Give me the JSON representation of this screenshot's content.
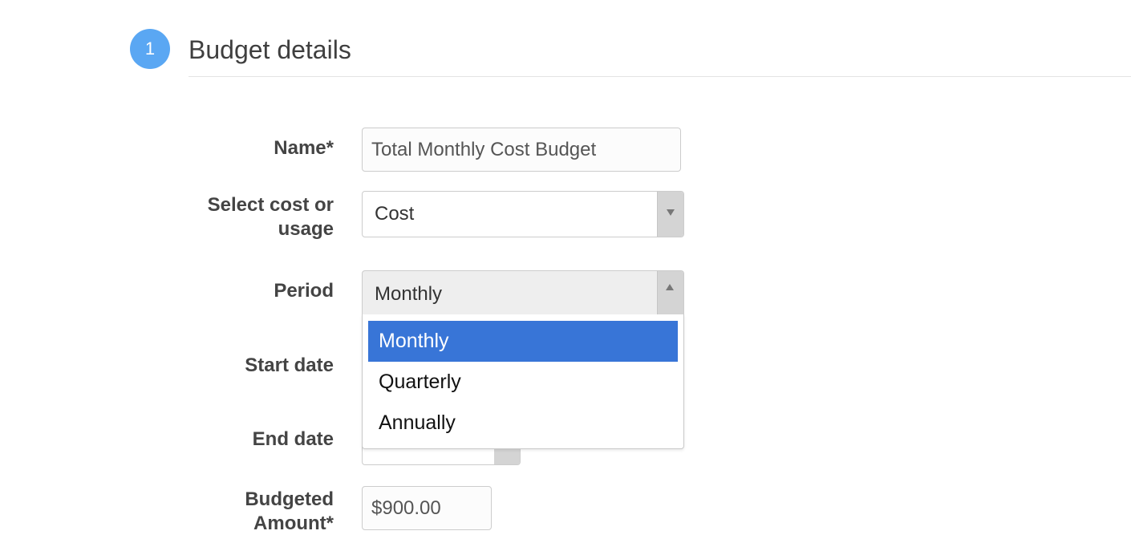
{
  "section": {
    "step_number": "1",
    "title": "Budget details"
  },
  "form": {
    "name": {
      "label": "Name*",
      "value": "Total Monthly Cost Budget"
    },
    "cost_or_usage": {
      "label_line1": "Select cost or",
      "label_line2": "usage",
      "value": "Cost"
    },
    "period": {
      "label": "Period",
      "value": "Monthly",
      "options": [
        "Monthly",
        "Quarterly",
        "Annually"
      ],
      "selected_index": 0,
      "open": true
    },
    "start_date": {
      "label": "Start date"
    },
    "end_date": {
      "label": "End date"
    },
    "budgeted_amount": {
      "label_line1": "Budgeted",
      "label_line2": "Amount*",
      "value": "$900.00"
    }
  },
  "colors": {
    "step_circle": "#5aa7f3",
    "option_highlight": "#3875d7"
  }
}
